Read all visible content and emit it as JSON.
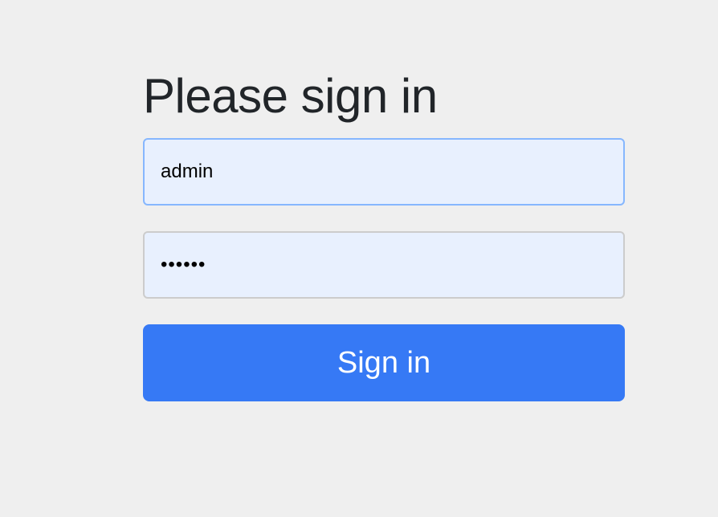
{
  "form": {
    "heading": "Please sign in",
    "username": {
      "value": "admin"
    },
    "password": {
      "value": "••••••"
    },
    "submit_label": "Sign in",
    "colors": {
      "page_background": "#efefef",
      "input_background": "#e8f0fe",
      "focused_border": "#86b7fe",
      "button_background": "#3679f5",
      "button_text": "#ffffff",
      "heading_text": "#212529"
    }
  }
}
